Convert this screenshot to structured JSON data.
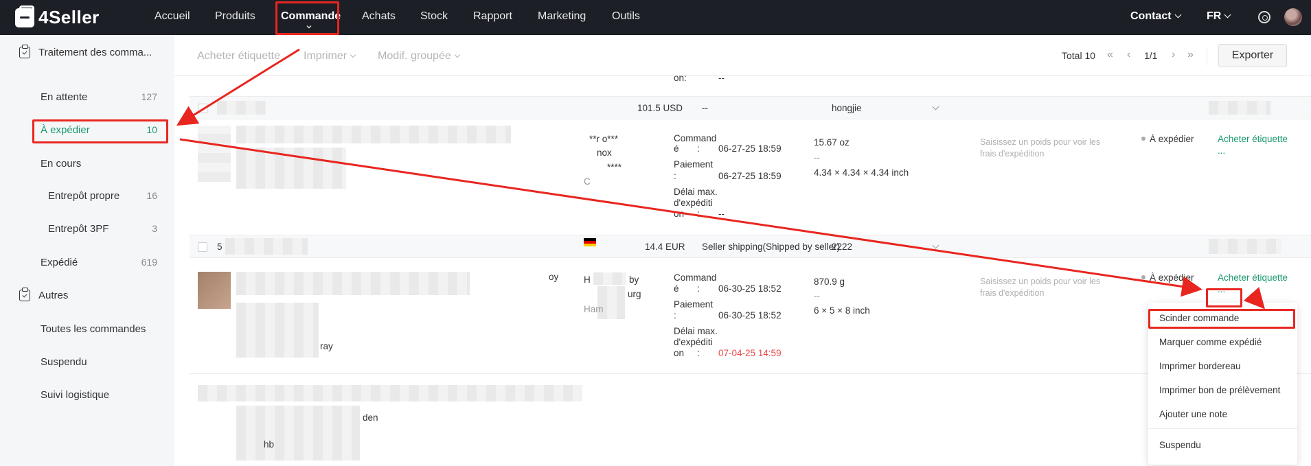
{
  "app": {
    "logo": "4Seller"
  },
  "nav": {
    "items": [
      "Accueil",
      "Produits",
      "Commande",
      "Achats",
      "Stock",
      "Rapport",
      "Marketing",
      "Outils"
    ],
    "contact": "Contact",
    "lang": "FR"
  },
  "sidebar": {
    "group1": "Traitement des comma...",
    "items": [
      {
        "label": "En attente",
        "count": "127"
      },
      {
        "label": "À expédier",
        "count": "10"
      },
      {
        "label": "En cours",
        "count": ""
      },
      {
        "label": "Entrepôt propre",
        "count": "16"
      },
      {
        "label": "Entrepôt 3PF",
        "count": "3"
      },
      {
        "label": "Expédié",
        "count": "619"
      }
    ],
    "group2": "Autres",
    "others": [
      "Toutes les commandes",
      "Suspendu",
      "Suivi logistique"
    ]
  },
  "toolbar": {
    "buy_label": "Acheter étiquette",
    "print": "Imprimer",
    "bulk_edit": "Modif. groupée",
    "total": "Total 10",
    "page": "1/1",
    "export": "Exporter"
  },
  "orders": {
    "top_residual": {
      "on": "on:",
      "dash": "--"
    },
    "order1": {
      "amount": "101.5 USD",
      "shipping": "--",
      "warehouse": "hongjie",
      "buyer_line1": "**r o***",
      "buyer_line2": "nox",
      "buyer_line3": "****",
      "buyer_line4": "C",
      "cmd_label": "Command",
      "cmd_label2": "é",
      "colon": ":",
      "cmd_date": "06-27-25 18:59",
      "pay_label": "Paiement",
      "pay_date": "06-27-25 18:59",
      "delay_label1": "Délai max.",
      "delay_label2": "d'expéditi",
      "delay_label3": "on",
      "delay_value": "--",
      "weight": "15.67 oz",
      "dash": "--",
      "dims": "4.34 × 4.34 × 4.34 inch",
      "weight_hint1": "Saisissez un poids pour voir les",
      "weight_hint2": "frais d'expédition",
      "status": "À expédier",
      "action": "Acheter étiquette",
      "more": "..."
    },
    "order2": {
      "id_prefix": "5",
      "amount": "14.4 EUR",
      "shipping": "Seller shipping(Shipped by seller)",
      "warehouse": "2222",
      "product_tail1": "oy",
      "product_tail2": "ray",
      "buyer_line1": "H",
      "buyer_line1_tail": "by",
      "buyer_city": "urg",
      "buyer_city2": "Ham",
      "cmd_label": "Command",
      "cmd_label2": "é",
      "colon": ":",
      "cmd_date": "06-30-25 18:52",
      "pay_label": "Paiement",
      "pay_date": "06-30-25 18:52",
      "delay_label1": "Délai max.",
      "delay_label2": "d'expéditi",
      "delay_label3": "on",
      "delay_value": "07-04-25 14:59",
      "weight": "870.9 g",
      "dash": "--",
      "dims": "6 × 5 × 8 inch",
      "weight_hint1": "Saisissez un poids pour voir les",
      "weight_hint2": "frais d'expédition",
      "status": "À expédier",
      "action": "Acheter étiquette",
      "more": "..."
    },
    "order3": {
      "tail1": "den",
      "tail2": "hb"
    }
  },
  "dropdown": {
    "items": [
      "Scinder commande",
      "Marquer comme expédié",
      "Imprimer bordereau",
      "Imprimer bon de prélèvement",
      "Ajouter une note",
      "Suspendu"
    ]
  },
  "colors": {
    "accent": "#1a9a6c",
    "annotation": "#e8261f",
    "nav_bg": "#1c1f26"
  }
}
